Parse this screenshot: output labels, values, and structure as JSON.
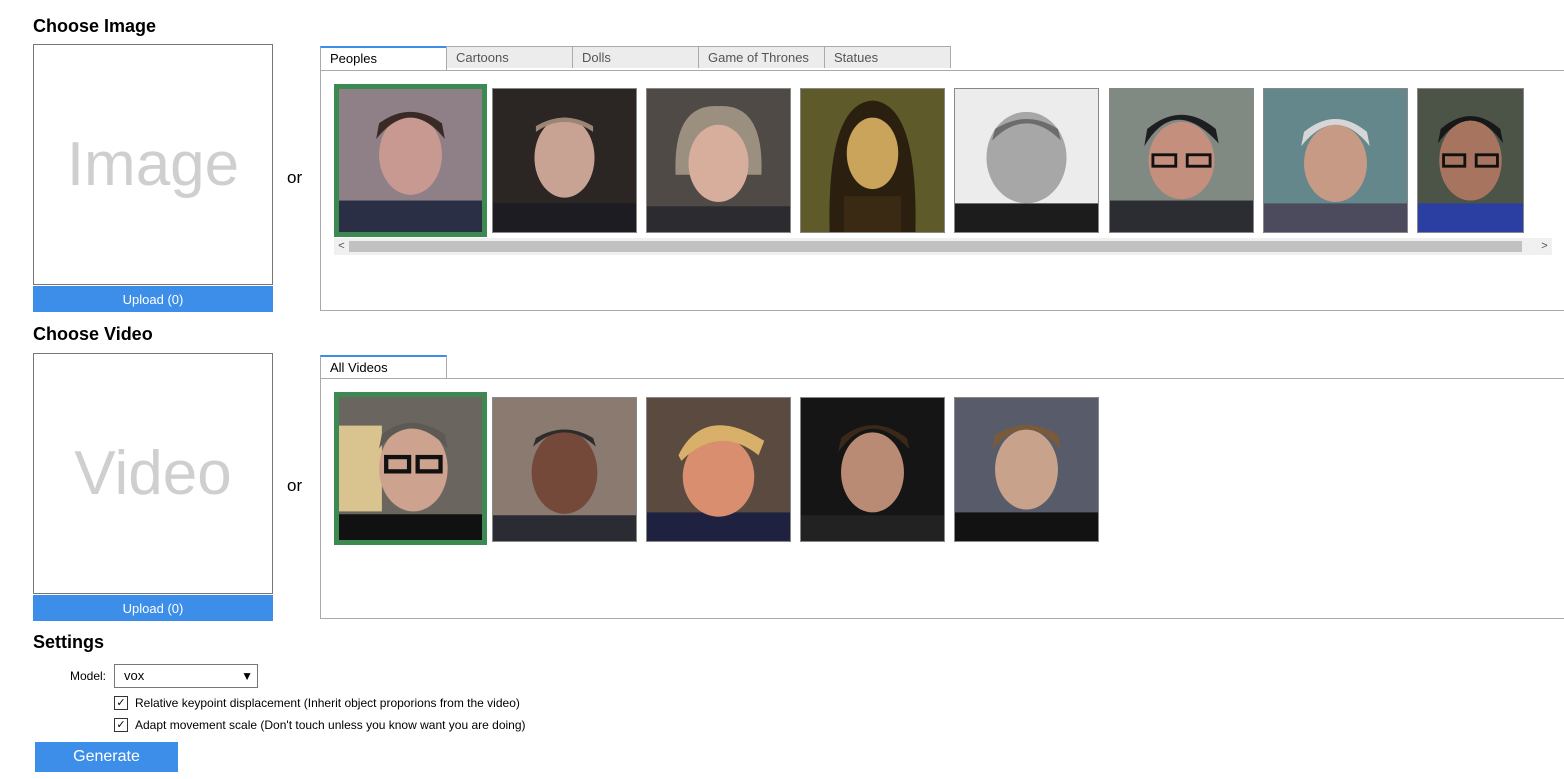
{
  "image_section": {
    "title": "Choose Image",
    "placeholder": "Image",
    "upload_label": "Upload (0)",
    "or_text": "or",
    "tabs": [
      "Peoples",
      "Cartoons",
      "Dolls",
      "Game of Thrones",
      "Statues"
    ],
    "active_tab": "Peoples"
  },
  "video_section": {
    "title": "Choose Video",
    "placeholder": "Video",
    "upload_label": "Upload (0)",
    "or_text": "or",
    "tabs": [
      "All Videos"
    ],
    "active_tab": "All Videos"
  },
  "settings": {
    "title": "Settings",
    "model_label": "Model:",
    "model_value": "vox",
    "relative_label": "Relative keypoint displacement (Inherit object proporions from the video)",
    "relative_checked": true,
    "adapt_label": "Adapt movement scale (Don't touch unless you know want you are doing)",
    "adapt_checked": true,
    "generate_label": "Generate"
  },
  "colors": {
    "accent": "#3d8ee8",
    "selected_border": "#3c8a52"
  },
  "scroll_arrows": {
    "left": "<",
    "right": ">"
  }
}
